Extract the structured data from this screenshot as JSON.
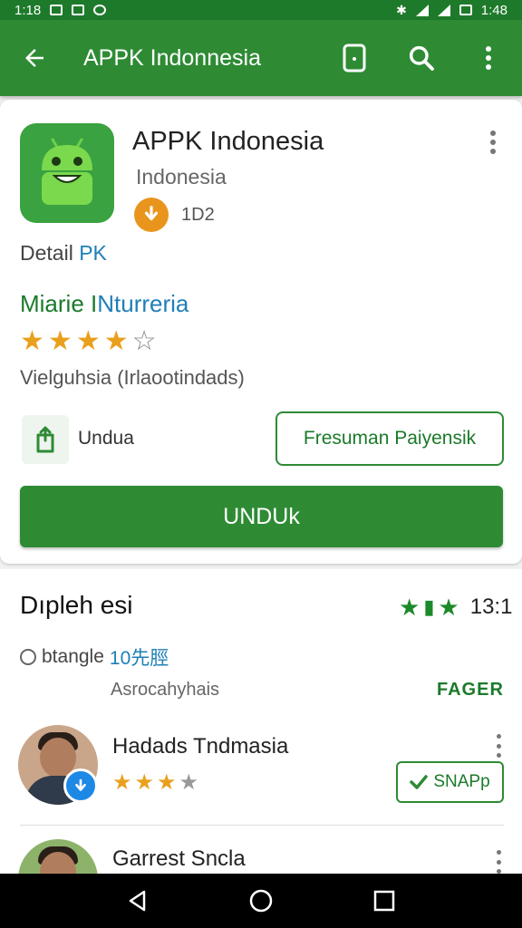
{
  "status_bar": {
    "time_left": "1:18",
    "time_right": "1:48"
  },
  "app_bar": {
    "title": "APPK Indonnesia"
  },
  "app": {
    "name": "APPK Indonesia",
    "subtitle": "Indonesia",
    "download_count": "1D2",
    "detail_label": "Detail",
    "detail_accent": "PK",
    "section_title_a": "Miarie I",
    "section_title_b": "Nturreria",
    "rating": 4,
    "rating_max": 5,
    "meta": "Vielguhsia (Irlaootindads)",
    "share_label": "Undua",
    "secondary_button": "Fresuman Paiyensik",
    "primary_button": "UNDUk"
  },
  "reviews": {
    "title": "Dıpleh esi",
    "score_stars": 3,
    "score": "13:1",
    "filter_text": "btangle",
    "filter_accent": "10先脛",
    "subhead": "Asrocahyhais",
    "sort_label": "FAGER",
    "items": [
      {
        "name": "Hadads Tndmasia",
        "rating": 3,
        "button_label": "SNAPp"
      },
      {
        "name": "Garrest Sncla"
      }
    ]
  },
  "colors": {
    "brand_green": "#2e8b34",
    "accent_blue": "#1f7fb8",
    "star_orange": "#e9a01d"
  }
}
